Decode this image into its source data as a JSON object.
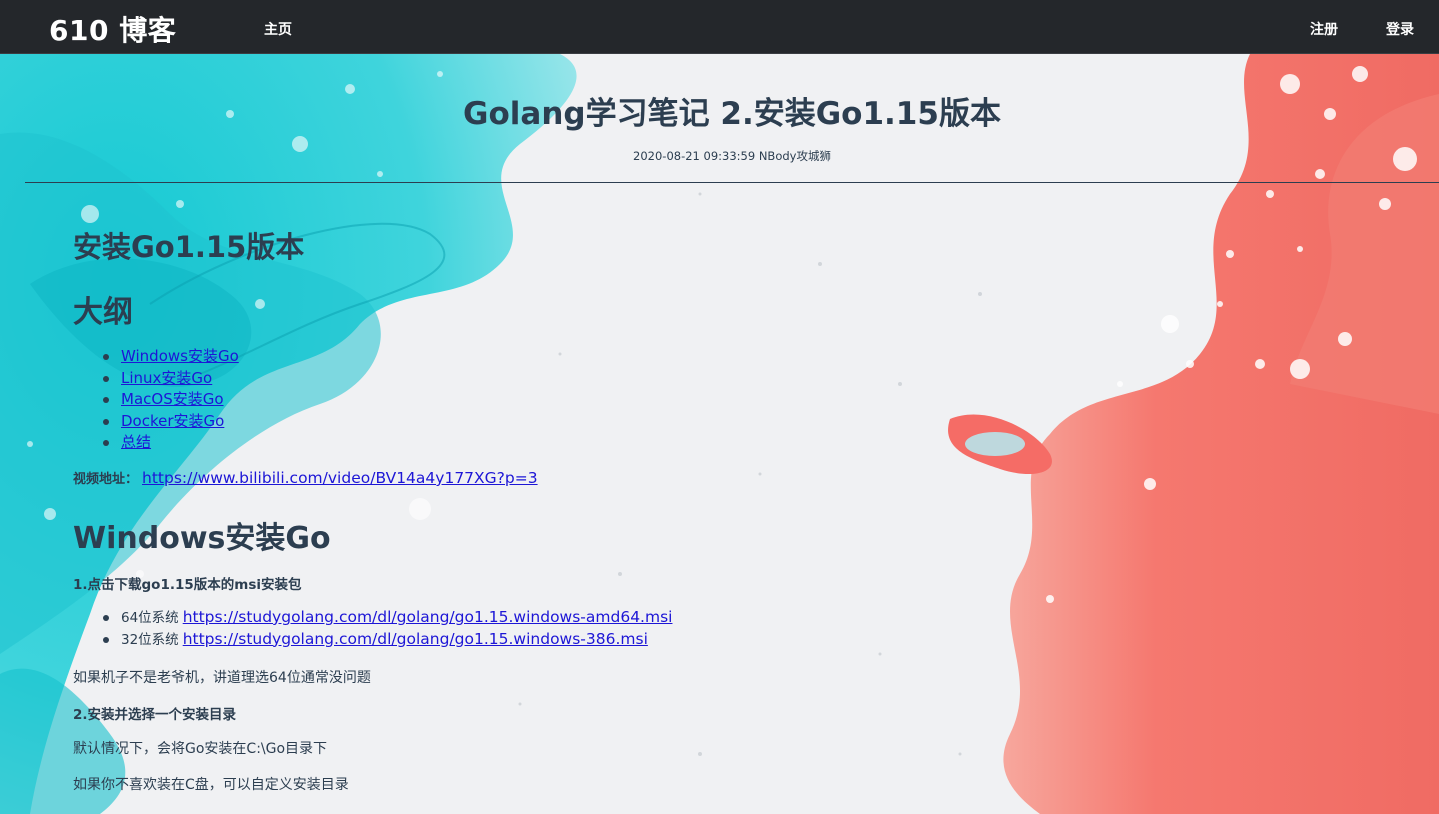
{
  "navbar": {
    "brand": "610 博客",
    "home": "主页",
    "register": "注册",
    "login": "登录"
  },
  "post": {
    "title": "Golang学习笔记 2.安装Go1.15版本",
    "meta": "2020-08-21 09:33:59 NBody攻城狮"
  },
  "article": {
    "h_install": "安装Go1.15版本",
    "h_outline": "大纲",
    "toc": [
      "Windows安装Go",
      "Linux安装Go",
      "MacOS安装Go",
      "Docker安装Go",
      "总结"
    ],
    "video_label": "视频地址：",
    "video_url": "https://www.bilibili.com/video/BV14a4y177XG?p=3",
    "h_windows": "Windows安装Go",
    "step1": "1.点击下载go1.15版本的msi安装包",
    "downloads": [
      {
        "system": "64位系统",
        "url": "https://studygolang.com/dl/golang/go1.15.windows-amd64.msi"
      },
      {
        "system": "32位系统",
        "url": "https://studygolang.com/dl/golang/go1.15.windows-386.msi"
      }
    ],
    "p_choose": "如果机子不是老爷机，讲道理选64位通常没问题",
    "step2": "2.安装并选择一个安装目录",
    "p_default": "默认情况下，会将Go安装在C:\\Go目录下",
    "p_custom": "如果你不喜欢装在C盘，可以自定义安装目录"
  },
  "colors": {
    "navbar_bg": "#24272b",
    "text": "#2c3e50",
    "link": "#1d16d6",
    "cyan": "#22cfd6",
    "coral": "#f5786f"
  }
}
